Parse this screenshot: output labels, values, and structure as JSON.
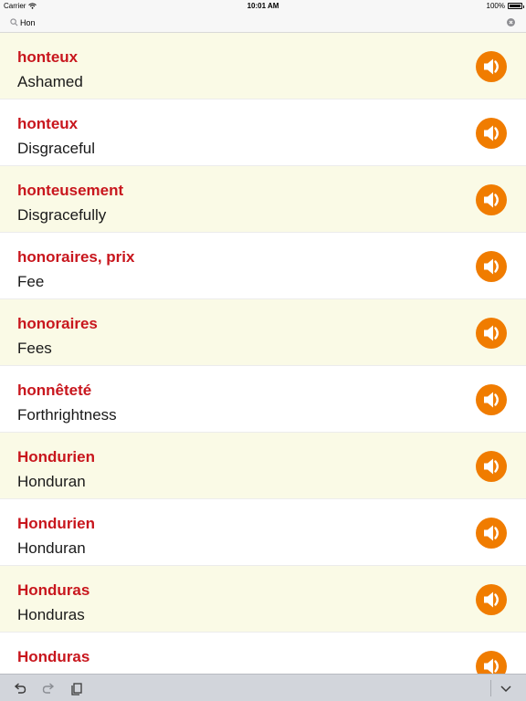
{
  "status_bar": {
    "carrier": "Carrier",
    "time": "10:01 AM",
    "battery": "100%"
  },
  "search": {
    "value": "Hon"
  },
  "colors": {
    "word": "#c8161d",
    "speaker": "#f07c00",
    "row_alt": "#fafae6"
  },
  "icons": {
    "search": "magnifier",
    "clear": "x-circle",
    "speaker": "speaker",
    "undo": "undo-arrow",
    "redo": "redo-arrow",
    "paste": "clipboard",
    "dismiss": "chevron-down"
  },
  "results": [
    {
      "word": "honteux",
      "translation": "Ashamed"
    },
    {
      "word": "honteux",
      "translation": "Disgraceful"
    },
    {
      "word": "honteusement",
      "translation": "Disgracefully"
    },
    {
      "word": "honoraires, prix",
      "translation": "Fee"
    },
    {
      "word": "honoraires",
      "translation": "Fees"
    },
    {
      "word": "honnêteté",
      "translation": "Forthrightness"
    },
    {
      "word": "Hondurien",
      "translation": "Honduran"
    },
    {
      "word": "Hondurien",
      "translation": "Honduran"
    },
    {
      "word": "Honduras",
      "translation": "Honduras"
    },
    {
      "word": "Honduras",
      "translation": ""
    }
  ]
}
